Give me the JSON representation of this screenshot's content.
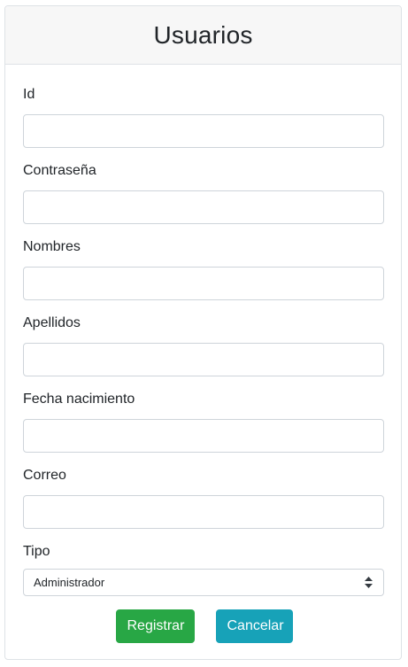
{
  "header": {
    "title": "Usuarios"
  },
  "form": {
    "fields": [
      {
        "label": "Id",
        "value": "",
        "placeholder": ""
      },
      {
        "label": "Contraseña",
        "value": "",
        "placeholder": ""
      },
      {
        "label": "Nombres",
        "value": "",
        "placeholder": ""
      },
      {
        "label": "Apellidos",
        "value": "",
        "placeholder": ""
      },
      {
        "label": "Fecha nacimiento",
        "value": "",
        "placeholder": ""
      },
      {
        "label": "Correo",
        "value": "",
        "placeholder": ""
      }
    ],
    "tipo": {
      "label": "Tipo",
      "selected": "Administrador"
    }
  },
  "buttons": {
    "register_label": "Registrar",
    "cancel_label": "Cancelar"
  },
  "colors": {
    "success": "#28a745",
    "info": "#17a2b8",
    "header_bg": "#f7f7f7",
    "border": "#ced4da"
  },
  "icons": {
    "select_arrows": "chevron-up-down-icon"
  }
}
